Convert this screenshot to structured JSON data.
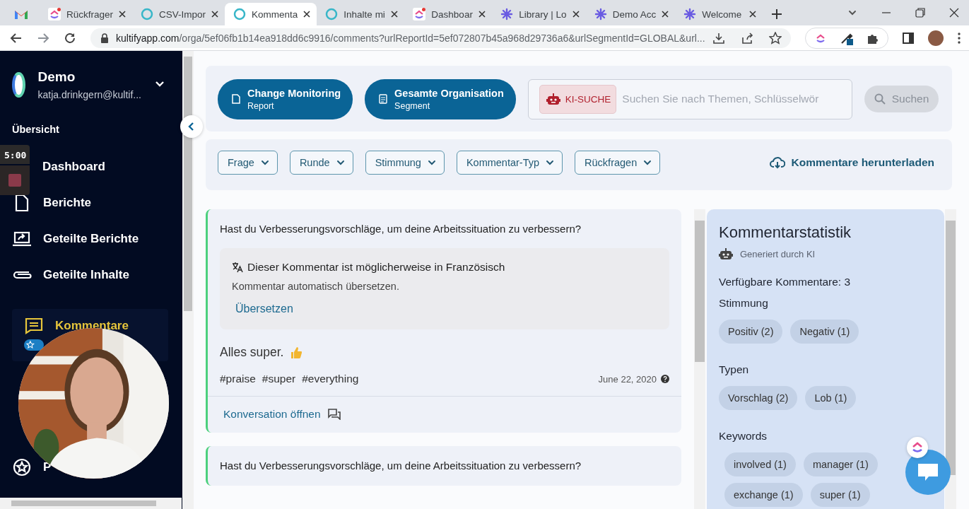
{
  "browser": {
    "tabs": [
      {
        "kind": "gmail",
        "selected": false
      },
      {
        "kind": "clickup",
        "title": "Rückfrager",
        "selected": false
      },
      {
        "kind": "ring",
        "title": "CSV-Impor",
        "selected": false
      },
      {
        "kind": "ring",
        "title": "Kommenta",
        "selected": true
      },
      {
        "kind": "ring",
        "title": "Inhalte mi",
        "selected": false
      },
      {
        "kind": "clickup",
        "title": "Dashboar",
        "selected": false
      },
      {
        "kind": "burst",
        "title": "Library | Lo",
        "selected": false
      },
      {
        "kind": "burst",
        "title": "Demo Acc",
        "selected": false
      },
      {
        "kind": "burst",
        "title": "Welcome",
        "selected": false
      }
    ],
    "url_host": "kultifyapp.com",
    "url_path": "/orga/5ef06fb1b14ea918dd6c9916/comments?urlReportId=5ef072807b45a968d29736a6&urlSegmentId=GLOBAL&url..."
  },
  "recorder": {
    "timer": "5:00"
  },
  "sidebar": {
    "org_name": "Demo",
    "email": "katja.drinkgern@kultif...",
    "section": "Übersicht",
    "items": [
      {
        "label": "Dashboard",
        "selected": false
      },
      {
        "label": "Berichte",
        "selected": false
      },
      {
        "label": "Geteilte Berichte",
        "selected": false
      },
      {
        "label": "Geteilte Inhalte",
        "selected": false
      },
      {
        "label": "Kommentare",
        "selected": true
      },
      {
        "label": "P",
        "selected": false
      }
    ]
  },
  "header": {
    "report": {
      "title": "Change Monitoring",
      "subtitle": "Report"
    },
    "segment": {
      "title": "Gesamte Organisation",
      "subtitle": "Segment"
    },
    "search": {
      "badge": "KI-SUCHE",
      "placeholder": "Suchen Sie nach Themen, Schlüsselwör",
      "button": "Suchen"
    }
  },
  "filters": [
    "Frage",
    "Runde",
    "Stimmung",
    "Kommentar-Typ",
    "Rückfragen"
  ],
  "download": "Kommentare herunterladen",
  "comments": [
    {
      "question": "Hast du Verbesserungsvorschläge, um deine Arbeitssituation zu verbessern?",
      "notice": "Dieser Kommentar ist möglicherweise in Französisch",
      "hint": "Kommentar automatisch übersetzen.",
      "action": "Übersetzen",
      "text": "Alles super.",
      "tags": [
        "#praise",
        "#super",
        "#everything"
      ],
      "date": "June 22, 2020",
      "open": "Konversation öffnen"
    },
    {
      "question": "Hast du Verbesserungsvorschläge, um deine Arbeitssituation zu verbessern?"
    }
  ],
  "stats": {
    "title": "Kommentarstatistik",
    "generated": "Generiert durch KI",
    "available": "Verfügbare Kommentare: 3",
    "groups": [
      {
        "heading": "Stimmung",
        "chips": [
          "Positiv (2)",
          "Negativ (1)"
        ]
      },
      {
        "heading": "Typen",
        "chips": [
          "Vorschlag (2)",
          "Lob (1)"
        ]
      },
      {
        "heading": "Keywords",
        "chips": [
          "involved (1)",
          "manager (1)",
          "exchange (1)",
          "super (1)"
        ]
      }
    ]
  }
}
